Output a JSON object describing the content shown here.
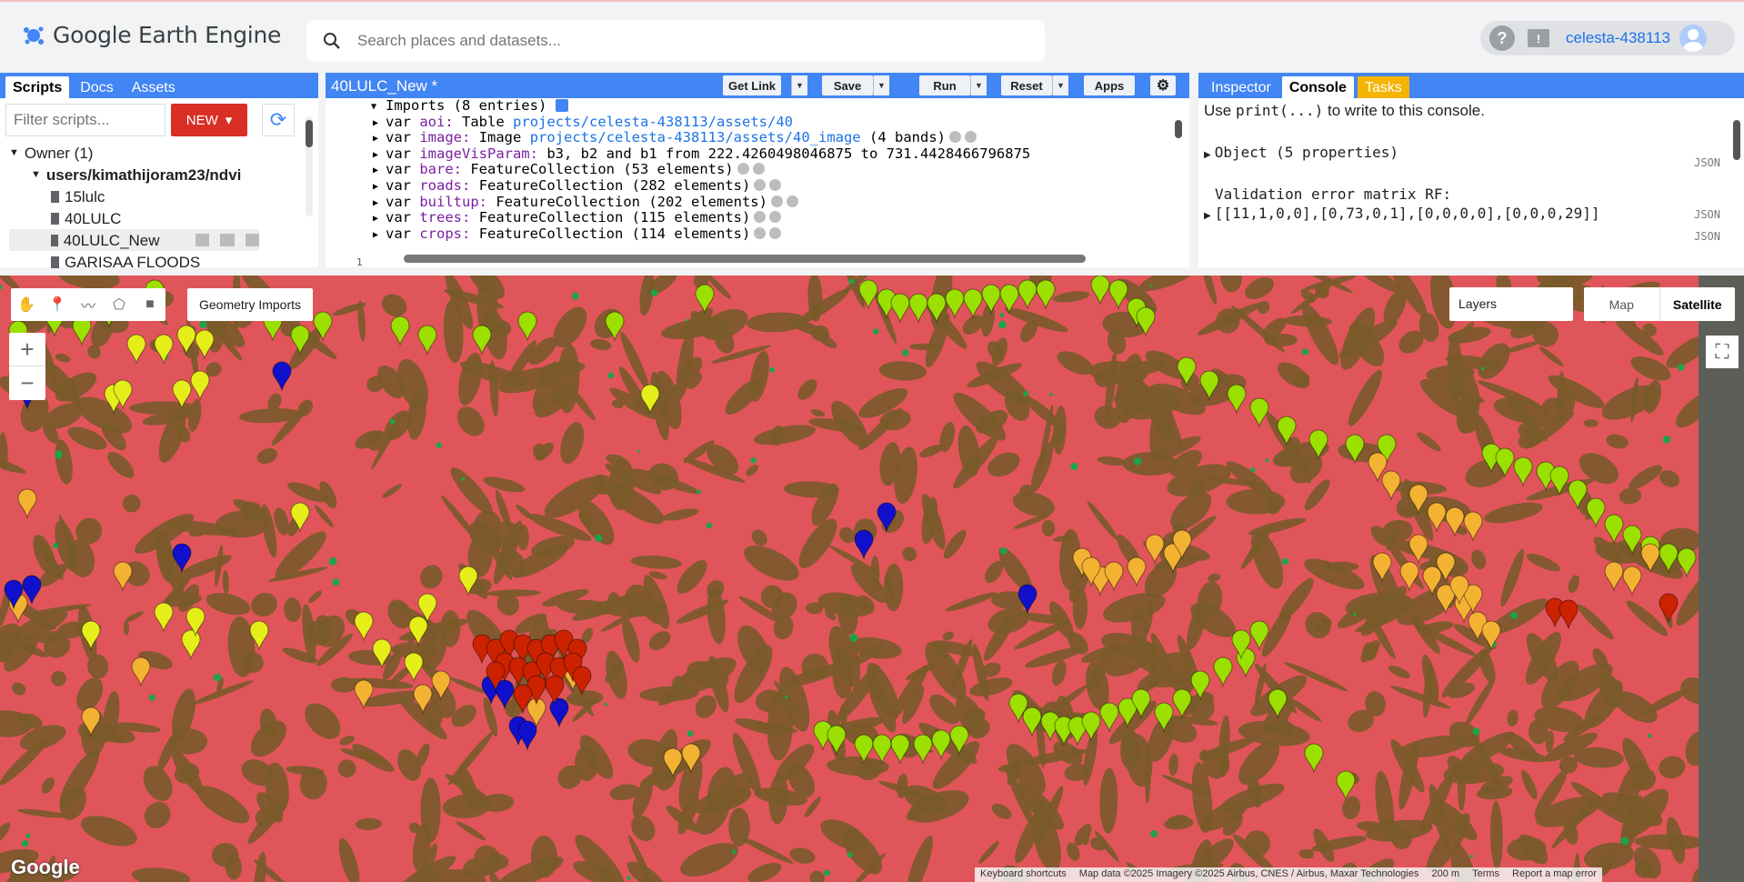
{
  "app": {
    "title": "Google Earth Engine",
    "search_placeholder": "Search places and datasets...",
    "user": "celesta-438113"
  },
  "left_panel": {
    "tabs": [
      "Scripts",
      "Docs",
      "Assets"
    ],
    "filter_placeholder": "Filter scripts...",
    "new_label": "NEW",
    "tree": {
      "owner": "Owner (1)",
      "repo": "users/kimathijoram23/ndvi",
      "files": [
        "15lulc",
        "40LULC",
        "40LULC_New",
        "GARISAA FLOODS"
      ]
    }
  },
  "editor": {
    "title": "40LULC_New *",
    "buttons": {
      "get_link": "Get Link",
      "save": "Save",
      "run": "Run",
      "reset": "Reset",
      "apps": "Apps"
    },
    "imports_header": "Imports (8 entries)",
    "line_number": "1",
    "imports": [
      {
        "name": "aoi",
        "type": "Table",
        "value": "projects/celesta-438113/assets/40",
        "link": true
      },
      {
        "name": "image",
        "type": "Image",
        "value": "projects/celesta-438113/assets/40_image",
        "link": true,
        "extra": "(4 bands)"
      },
      {
        "name": "imageVisParam",
        "type": "",
        "value": "b3, b2 and b1 from 222.4260498046875 to 731.4428466796875",
        "link": false
      },
      {
        "name": "bare",
        "type": "FeatureCollection",
        "value": "(53 elements)",
        "link": false
      },
      {
        "name": "roads",
        "type": "FeatureCollection",
        "value": "(282 elements)",
        "link": false
      },
      {
        "name": "builtup",
        "type": "FeatureCollection",
        "value": "(202 elements)",
        "link": false
      },
      {
        "name": "trees",
        "type": "FeatureCollection",
        "value": "(115 elements)",
        "link": false
      },
      {
        "name": "crops",
        "type": "FeatureCollection",
        "value": "(114 elements)",
        "link": false
      }
    ]
  },
  "right_panel": {
    "tabs": [
      "Inspector",
      "Console",
      "Tasks"
    ],
    "hint_prefix": "Use ",
    "hint_code": "print(...)",
    "hint_suffix": " to write to this console.",
    "object_line": "Object (5 properties)",
    "matrix_title": "Validation error matrix RF:",
    "matrix_value": "[[11,1,0,0],[0,73,0,1],[0,0,0,0],[0,0,0,29]]",
    "json_tag": "JSON"
  },
  "map": {
    "geometry_imports": "Geometry Imports",
    "layers": "Layers",
    "map_type": "Map",
    "satellite": "Satellite",
    "zoom_in": "+",
    "zoom_out": "−",
    "google": "Google",
    "attribution": [
      "Keyboard shortcuts",
      "Map data ©2025 Imagery ©2025 Airbus, CNES / Airbus, Maxar Technologies",
      "200 m",
      "Terms",
      "Report a map error"
    ],
    "colors": {
      "background": "#e0555a",
      "brown": "#7a5a2a",
      "green": "#1fa34a",
      "markers": {
        "lime": "#9be000",
        "yellow": "#e6ee1a",
        "orange": "#f4b233",
        "blue": "#1010cc",
        "red": "#cc2200"
      }
    }
  }
}
